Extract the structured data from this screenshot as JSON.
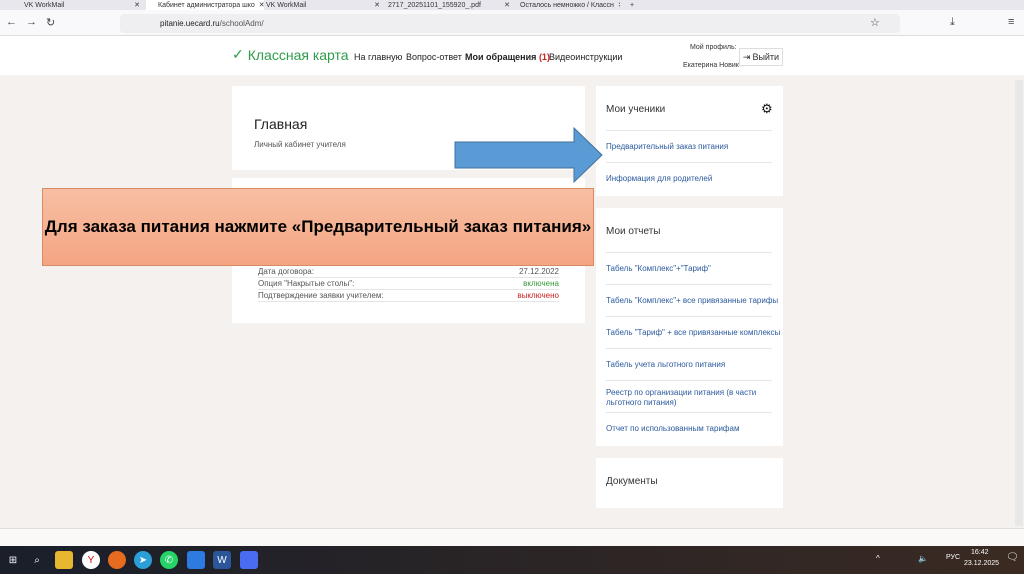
{
  "browser": {
    "tabs": [
      "VK WorkMail",
      "Кабинет администратора шко",
      "VK WorkMail",
      "2717_20251101_155920_.pdf",
      "Осталось немножко / Классн"
    ],
    "url_host": "pitanie.uecard.ru",
    "url_path": "/schoolAdm/"
  },
  "header": {
    "logo": "Классная карта",
    "nav": [
      "На главную",
      "Вопрос-ответ",
      "Мои обращения",
      "Видеоинструкции"
    ],
    "appeals_count": "(1)",
    "profile_label": "Мой профиль:",
    "user": "Екатерина Новик",
    "logout": "Выйти"
  },
  "main": {
    "title": "Главная",
    "subtitle": "Личный кабинет учителя",
    "info_rows": [
      {
        "label": "Дата договора:",
        "value": "27.12.2022"
      },
      {
        "label": "Опция \"Накрытые столы\":",
        "value": "включена"
      },
      {
        "label": "Подтверждение заявки учителем:",
        "value": "выключено"
      }
    ]
  },
  "students": {
    "title": "Мои ученики",
    "links": [
      "Предварительный заказ питания",
      "Информация для родителей"
    ]
  },
  "reports": {
    "title": "Мои отчеты",
    "links": [
      "Табель \"Комплекс\"+\"Тариф\"",
      "Табель \"Комплекс\"+ все привязанные тарифы",
      "Табель \"Тариф\" + все привязанные комплексы",
      "Табель учета льготного питания",
      "Реестр по организации питания (в части льготного питания)",
      "Отчет по использованным тарифам"
    ]
  },
  "documents": {
    "title": "Документы"
  },
  "callout": "Для заказа питания нажмите «Предварительный заказ питания»",
  "taskbar": {
    "lang": "РУС",
    "time": "16:42",
    "date": "23.12.2025"
  },
  "colors": {
    "green": "#3a9a3a",
    "red": "#cc2222",
    "link": "#2b5a9e"
  }
}
